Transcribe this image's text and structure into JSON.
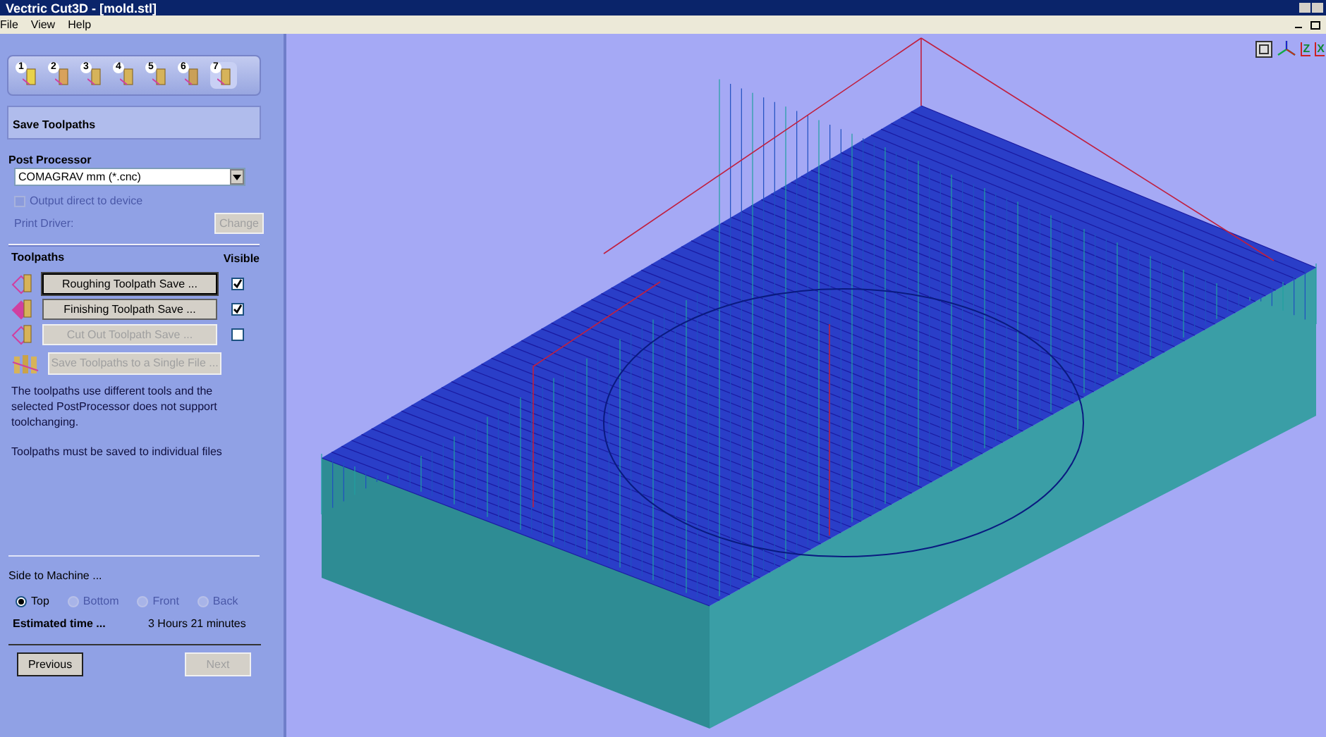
{
  "window": {
    "title": "Vectric Cut3D - [mold.stl]"
  },
  "menu": [
    "File",
    "View",
    "Help"
  ],
  "steps": [
    {
      "label": "1",
      "selected": false
    },
    {
      "label": "2",
      "selected": false
    },
    {
      "label": "3",
      "selected": false
    },
    {
      "label": "4",
      "selected": false
    },
    {
      "label": "5",
      "selected": false
    },
    {
      "label": "6",
      "selected": false
    },
    {
      "label": "7",
      "selected": true
    }
  ],
  "page_title": "Save Toolpaths",
  "post_processor": {
    "label": "Post Processor",
    "value": "COMAGRAV mm (*.cnc)",
    "output_direct": {
      "label": "Output direct to device",
      "checked": false,
      "disabled": true
    },
    "print_driver": "Print Driver:",
    "change_button": {
      "label": "Change",
      "disabled": true
    }
  },
  "toolpaths": {
    "label": "Toolpaths",
    "visible_label": "Visible",
    "items": [
      {
        "label": "Roughing Toolpath Save ...",
        "disabled": false,
        "visible": true,
        "focused": true
      },
      {
        "label": "Finishing Toolpath Save ...",
        "disabled": false,
        "visible": true,
        "focused": false
      },
      {
        "label": "Cut Out Toolpath Save ...",
        "disabled": true,
        "visible": false,
        "focused": false
      }
    ],
    "single_file": {
      "label": "Save Toolpaths to a Single File ...",
      "disabled": true
    },
    "notes": [
      "The toolpaths use different tools and the selected PostProcessor does not support toolchanging.",
      "Toolpaths must be saved to individual files"
    ]
  },
  "side_to_machine": {
    "label": "Side to Machine ...",
    "options": [
      {
        "label": "Top",
        "selected": true,
        "disabled": false
      },
      {
        "label": "Bottom",
        "selected": false,
        "disabled": true
      },
      {
        "label": "Front",
        "selected": false,
        "disabled": true
      },
      {
        "label": "Back",
        "selected": false,
        "disabled": true
      }
    ]
  },
  "estimated_time": {
    "label": "Estimated time ...",
    "value": "3 Hours 21 minutes"
  },
  "nav_buttons": [
    {
      "label": "Previous",
      "disabled": false
    },
    {
      "label": "Next",
      "disabled": true
    }
  ],
  "view_toolbar": [
    {
      "label": "Z"
    },
    {
      "label": "X"
    }
  ]
}
